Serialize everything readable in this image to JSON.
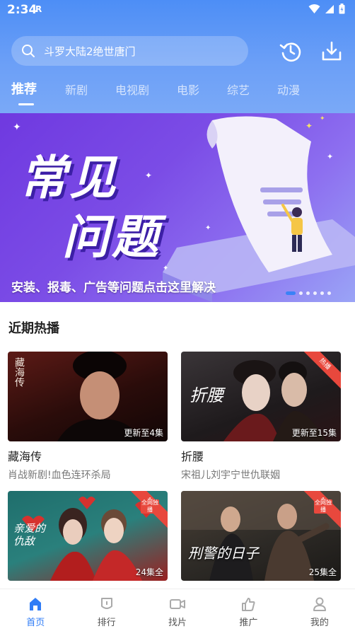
{
  "status": {
    "time": "2:34",
    "indicator": "R"
  },
  "search": {
    "text": "斗罗大陆2绝世唐门"
  },
  "tabs": [
    {
      "label": "推荐",
      "active": true
    },
    {
      "label": "新剧"
    },
    {
      "label": "电视剧"
    },
    {
      "label": "电影"
    },
    {
      "label": "综艺"
    },
    {
      "label": "动漫"
    }
  ],
  "banner": {
    "line1": "常见",
    "line2": "问题",
    "caption": "安装、报毒、广告等问题点击这里解决",
    "dot_count": 6,
    "active_dot": 0
  },
  "section": {
    "title": "近期热播"
  },
  "cards": [
    {
      "title": "藏海传",
      "subtitle": "肖战新剧!血色连环杀局",
      "update": "更新至4集",
      "poster_text": "藏海传",
      "badge": ""
    },
    {
      "title": "折腰",
      "subtitle": "宋祖儿刘宇宁世仇联姻",
      "update": "更新至15集",
      "poster_text": "折腰",
      "badge": "热播"
    },
    {
      "title": "",
      "subtitle": "",
      "update": "24集全",
      "poster_text": "亲爱的仇敌",
      "badge": "热播",
      "badge2": "全网独播"
    },
    {
      "title": "",
      "subtitle": "",
      "update": "25集全",
      "poster_text": "刑警的日子",
      "badge": "热播",
      "badge2": "全网独播"
    }
  ],
  "nav": [
    {
      "label": "首页",
      "icon": "home-icon",
      "active": true
    },
    {
      "label": "排行",
      "icon": "ranking-icon"
    },
    {
      "label": "找片",
      "icon": "video-camera-icon"
    },
    {
      "label": "推广",
      "icon": "thumbs-up-icon"
    },
    {
      "label": "我的",
      "icon": "user-icon"
    }
  ],
  "colors": {
    "accent": "#2f7cf6",
    "header": "#5a94f6",
    "hot_badge": "#e8483d"
  }
}
